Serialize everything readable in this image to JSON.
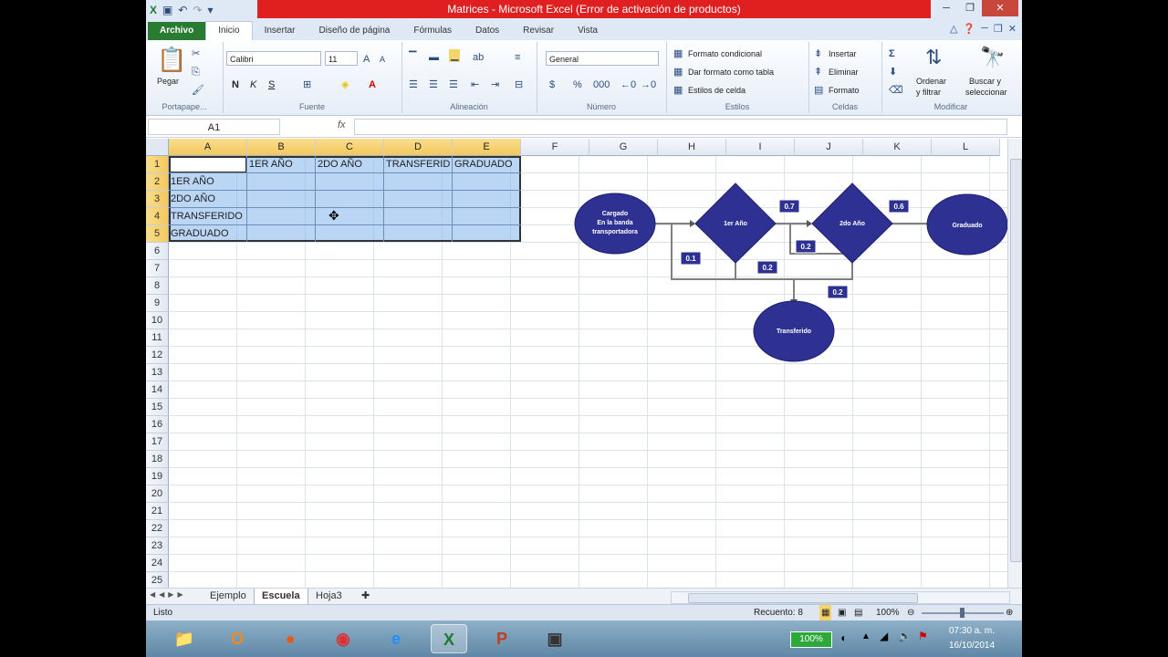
{
  "window": {
    "title": "Matrices - Microsoft Excel (Error de activación de productos)"
  },
  "qat": {
    "save": "save-icon",
    "undo": "undo-icon",
    "redo": "redo-icon"
  },
  "tabs": [
    {
      "label": "Archivo"
    },
    {
      "label": "Inicio"
    },
    {
      "label": "Insertar"
    },
    {
      "label": "Diseño de página"
    },
    {
      "label": "Fórmulas"
    },
    {
      "label": "Datos"
    },
    {
      "label": "Revisar"
    },
    {
      "label": "Vista"
    }
  ],
  "ribbon": {
    "clipboard": {
      "paste": "Pegar",
      "label": "Portapape..."
    },
    "font": {
      "name": "Calibri",
      "size": "11",
      "label": "Fuente",
      "bold": "N",
      "italic": "K",
      "underline": "S"
    },
    "align": {
      "label": "Alineación"
    },
    "number": {
      "format": "General",
      "label": "Número"
    },
    "styles": {
      "cond": "Formato condicional",
      "table": "Dar formato como tabla",
      "cell": "Estilos de celda",
      "label": "Estilos"
    },
    "cells": {
      "insert": "Insertar",
      "delete": "Eliminar",
      "format": "Formato",
      "label": "Celdas"
    },
    "modify": {
      "sort": "Ordenar",
      "sort2": "y filtrar",
      "find": "Buscar y",
      "find2": "seleccionar",
      "label": "Modificar"
    }
  },
  "formula": {
    "namebox": "A1",
    "fx": "fx",
    "value": ""
  },
  "columns": [
    "A",
    "B",
    "C",
    "D",
    "E",
    "F",
    "G",
    "H",
    "I",
    "J",
    "K",
    "L"
  ],
  "rows": [
    "1",
    "2",
    "3",
    "4",
    "5",
    "6",
    "7",
    "8",
    "9",
    "10",
    "11",
    "12",
    "13",
    "14",
    "15",
    "16",
    "17",
    "18",
    "19",
    "20",
    "21",
    "22",
    "23",
    "24",
    "25"
  ],
  "table": {
    "headers": [
      "",
      "1ER AÑO",
      "2DO AÑO",
      "TRANSFERID",
      "GRADUADO"
    ],
    "row_labels": [
      "1ER AÑO",
      "2DO AÑO",
      "TRANSFERIDO",
      "GRADUADO"
    ]
  },
  "diagram": {
    "start": [
      "Cargado",
      "En la banda",
      "transportadora"
    ],
    "year1": "1er Año",
    "year2": "2do Año",
    "graduated": "Graduado",
    "transferred": "Transferido",
    "p_year1_year2": "0.7",
    "p_year2_graduated": "0.6",
    "p_year1_loop": "0.1",
    "p_year1_transferred": "0.2",
    "p_year2_loop": "0.2",
    "p_year2_transferred": "0.2"
  },
  "sheets": [
    {
      "label": "Ejemplo"
    },
    {
      "label": "Escuela"
    },
    {
      "label": "Hoja3"
    }
  ],
  "status": {
    "left": "Listo",
    "count": "Recuento: 8",
    "zoom": "100%"
  },
  "taskbar": {
    "battery": "100%",
    "time": "07:30 a. m.",
    "date": "16/10/2014"
  }
}
